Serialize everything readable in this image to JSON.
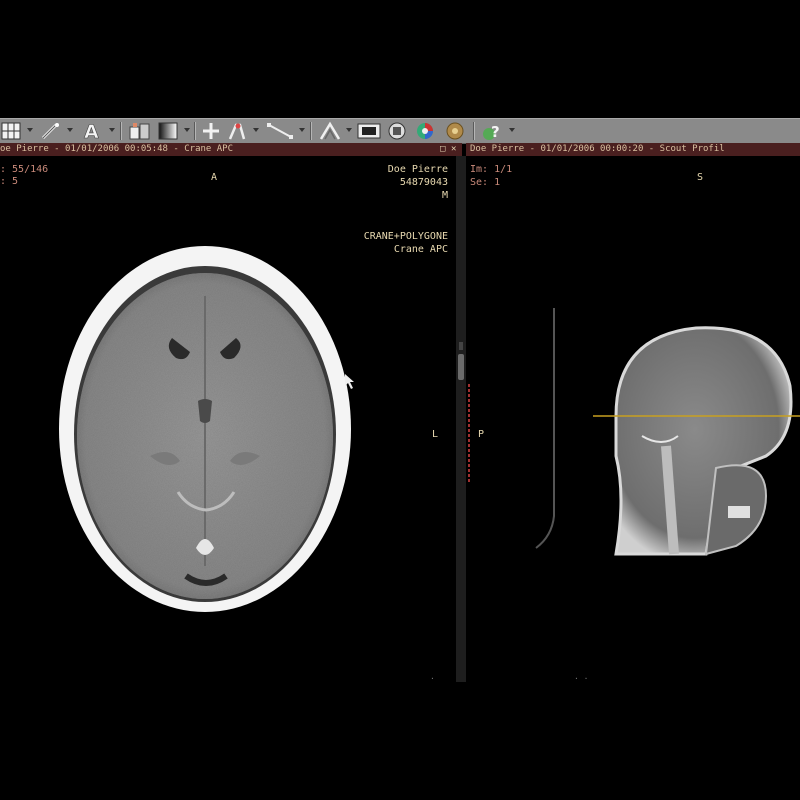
{
  "toolbar": {
    "icons": [
      "layout-grid-icon",
      "magic-wand-icon",
      "text-annotation-icon",
      "window-level-icon",
      "gradient-icon",
      "crosshair-icon",
      "pan-tool-icon",
      "ruler-measure-icon",
      "reslice-icon",
      "film-icon",
      "volume-icon",
      "color-map-icon",
      "settings-disc-icon",
      "help-icon"
    ]
  },
  "left_view": {
    "title": "oe Pierre - 01/01/2006 00:05:48 - Crane APC",
    "image_line": ": 55/146",
    "series_line": ": 5",
    "orient_top": "A",
    "orient_right": "L",
    "patient_name": "Doe Pierre",
    "patient_id": "54879043",
    "sex": "M",
    "study_desc": "CRANE+POLYGONE",
    "series_desc": "Crane APC"
  },
  "right_view": {
    "title": "Doe Pierre - 01/01/2006 00:00:20 - Scout Profil",
    "image_line": "Im: 1/1",
    "series_line": "Se: 1",
    "orient_top": "S",
    "orient_left": "P"
  },
  "colors": {
    "titlebar_bg": "#4a1f1f",
    "toolbar_bg": "#8a8a8a",
    "overlay_red": "#c98a7a",
    "overlay_cream": "#e8d9b0",
    "reference_line": "#c8a020"
  }
}
